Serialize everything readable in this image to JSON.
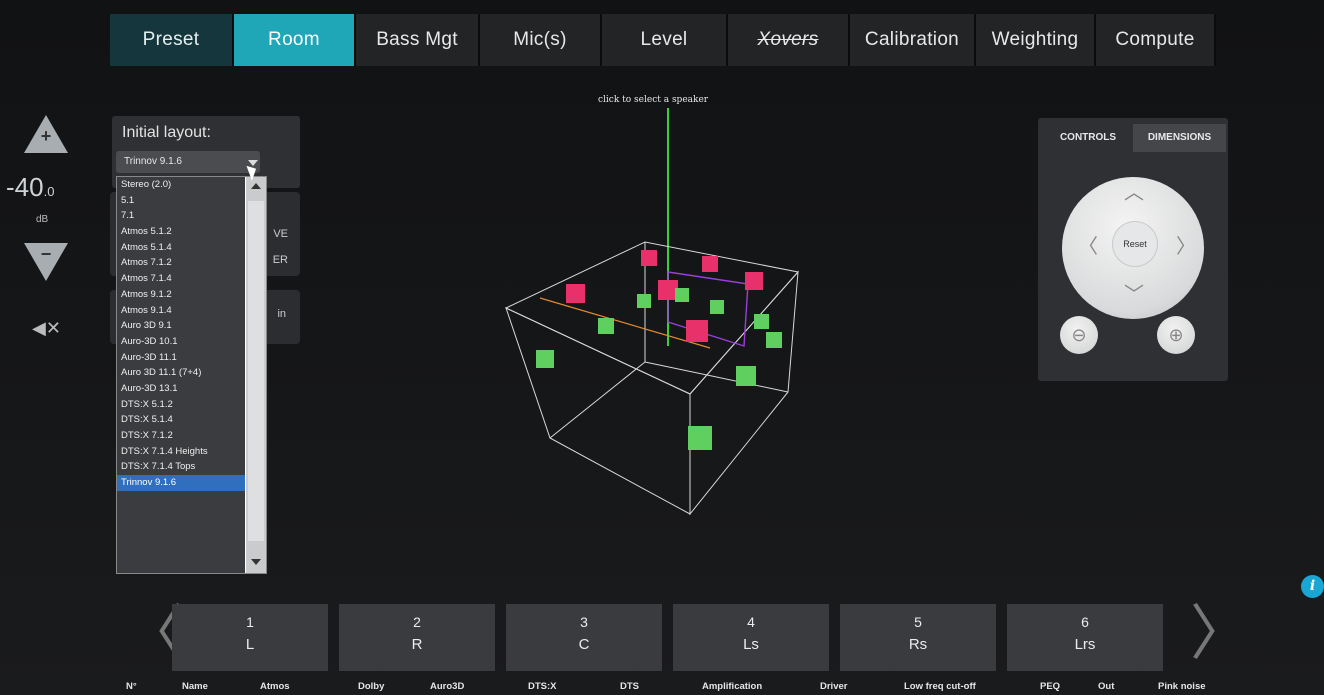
{
  "tabs": [
    {
      "label": "Preset",
      "state": "dark"
    },
    {
      "label": "Room",
      "state": "active"
    },
    {
      "label": "Bass Mgt",
      "state": "normal"
    },
    {
      "label": "Mic(s)",
      "state": "normal"
    },
    {
      "label": "Level",
      "state": "normal"
    },
    {
      "label": "Xovers",
      "state": "strike"
    },
    {
      "label": "Calibration",
      "state": "normal"
    },
    {
      "label": "Weighting",
      "state": "normal"
    },
    {
      "label": "Compute",
      "state": "normal"
    }
  ],
  "volume": {
    "value": "-40",
    "decimal": ".0",
    "unit": "dB"
  },
  "initial_layout": {
    "label": "Initial layout:",
    "selected": "Trinnov 9.1.6",
    "options": [
      "Stereo (2.0)",
      "5.1",
      "7.1",
      "Atmos 5.1.2",
      "Atmos 5.1.4",
      "Atmos 7.1.2",
      "Atmos 7.1.4",
      "Atmos 9.1.2",
      "Atmos 9.1.4",
      "Auro 3D 9.1",
      "Auro-3D 10.1",
      "Auro-3D 11.1",
      "Auro 3D 11.1 (7+4)",
      "Auro-3D 13.1",
      "DTS:X 5.1.2",
      "DTS:X 5.1.4",
      "DTS:X 7.1.2",
      "DTS:X 7.1.4 Heights",
      "DTS:X 7.1.4 Tops",
      "Trinnov 9.1.6"
    ]
  },
  "side_buttons": {
    "b1_line1": "VE",
    "b1_line2": "ER",
    "b2_line1": "in"
  },
  "view": {
    "hint": "click to select a speaker"
  },
  "controls": {
    "tab_controls": "CONTROLS",
    "tab_dimensions": "DIMENSIONS",
    "reset": "Reset"
  },
  "speakers": [
    {
      "num": "1",
      "name": "L"
    },
    {
      "num": "2",
      "name": "R"
    },
    {
      "num": "3",
      "name": "C"
    },
    {
      "num": "4",
      "name": "Ls"
    },
    {
      "num": "5",
      "name": "Rs"
    },
    {
      "num": "6",
      "name": "Lrs"
    }
  ],
  "columns": [
    "N°",
    "Name",
    "Atmos",
    "Dolby",
    "Auro3D",
    "DTS:X",
    "DTS",
    "Amplification",
    "Driver",
    "Low freq cut-off",
    "PEQ",
    "Out",
    "Pink noise"
  ],
  "colors": {
    "accent": "#1fa7b8",
    "preset": "#15363c",
    "speaker_selected": "#e8306a",
    "speaker": "#5fcf5f"
  }
}
